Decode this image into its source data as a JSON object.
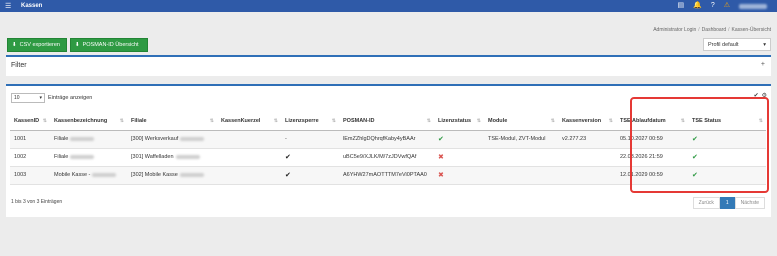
{
  "topbar": {
    "menu_icon": "☰",
    "title": "Kassen",
    "icons": [
      "▤",
      "🔔",
      "?"
    ],
    "warn_icon": "⚠"
  },
  "breadcrumb": [
    "Administrator Login",
    "Dashboard",
    "Kassen-Übersicht"
  ],
  "toolbar": {
    "csv_label": "CSV exportieren",
    "posman_label": "POSMAN-ID Übersicht",
    "profile_value": "Profil default"
  },
  "filter": {
    "label": "Filter",
    "toggle": "+"
  },
  "entries": {
    "value": "10",
    "label": "Einträge anzeigen"
  },
  "table": {
    "columns": [
      "KassenID",
      "Kassenbezeichnung",
      "Filiale",
      "KassenKuerzel",
      "Lizenzsperre",
      "POSMAN-ID",
      "Lizenzstatus",
      "Module",
      "Kassenversion",
      "TSE Ablaufdatum",
      "TSE Status"
    ],
    "rows": [
      {
        "id": "1001",
        "name": "Filiale",
        "filiale": "[300] Werksverkauf",
        "kuerzel": "",
        "sperre": "-",
        "posman": "lEmZZhlgDQhrqfKaby4yBAAr",
        "lizenz": "ok",
        "module": "TSE-Modul, ZVT-Modul",
        "version": "v2.277.23",
        "tse_date": "05.10.2027 00:59",
        "tse_status": "ok"
      },
      {
        "id": "1002",
        "name": "Filiale",
        "filiale": "[301] Waffelladen",
        "kuerzel": "",
        "sperre": "check",
        "posman": "uBC5e9/XJLK/M/7zJDVwfQAf",
        "lizenz": "bad",
        "module": "",
        "version": "",
        "tse_date": "22.03.2026 21:59",
        "tse_status": "ok"
      },
      {
        "id": "1003",
        "name": "Mobile Kasse -",
        "filiale": "[302] Mobile Kasse",
        "kuerzel": "",
        "sperre": "check",
        "posman": "A6YHW27mAOTTTM7eVi0PTAA0",
        "lizenz": "bad",
        "module": "",
        "version": "",
        "tse_date": "12.01.2029 00:59",
        "tse_status": "ok"
      }
    ]
  },
  "footer": {
    "info": "1 bis 3 von 3 Einträgen",
    "prev": "Zurück",
    "page": "1",
    "next": "Nächste"
  },
  "colors": {
    "accent": "#2f5aa8",
    "green": "#2e9a43",
    "red": "#d9534f",
    "highlight": "#e53935"
  }
}
